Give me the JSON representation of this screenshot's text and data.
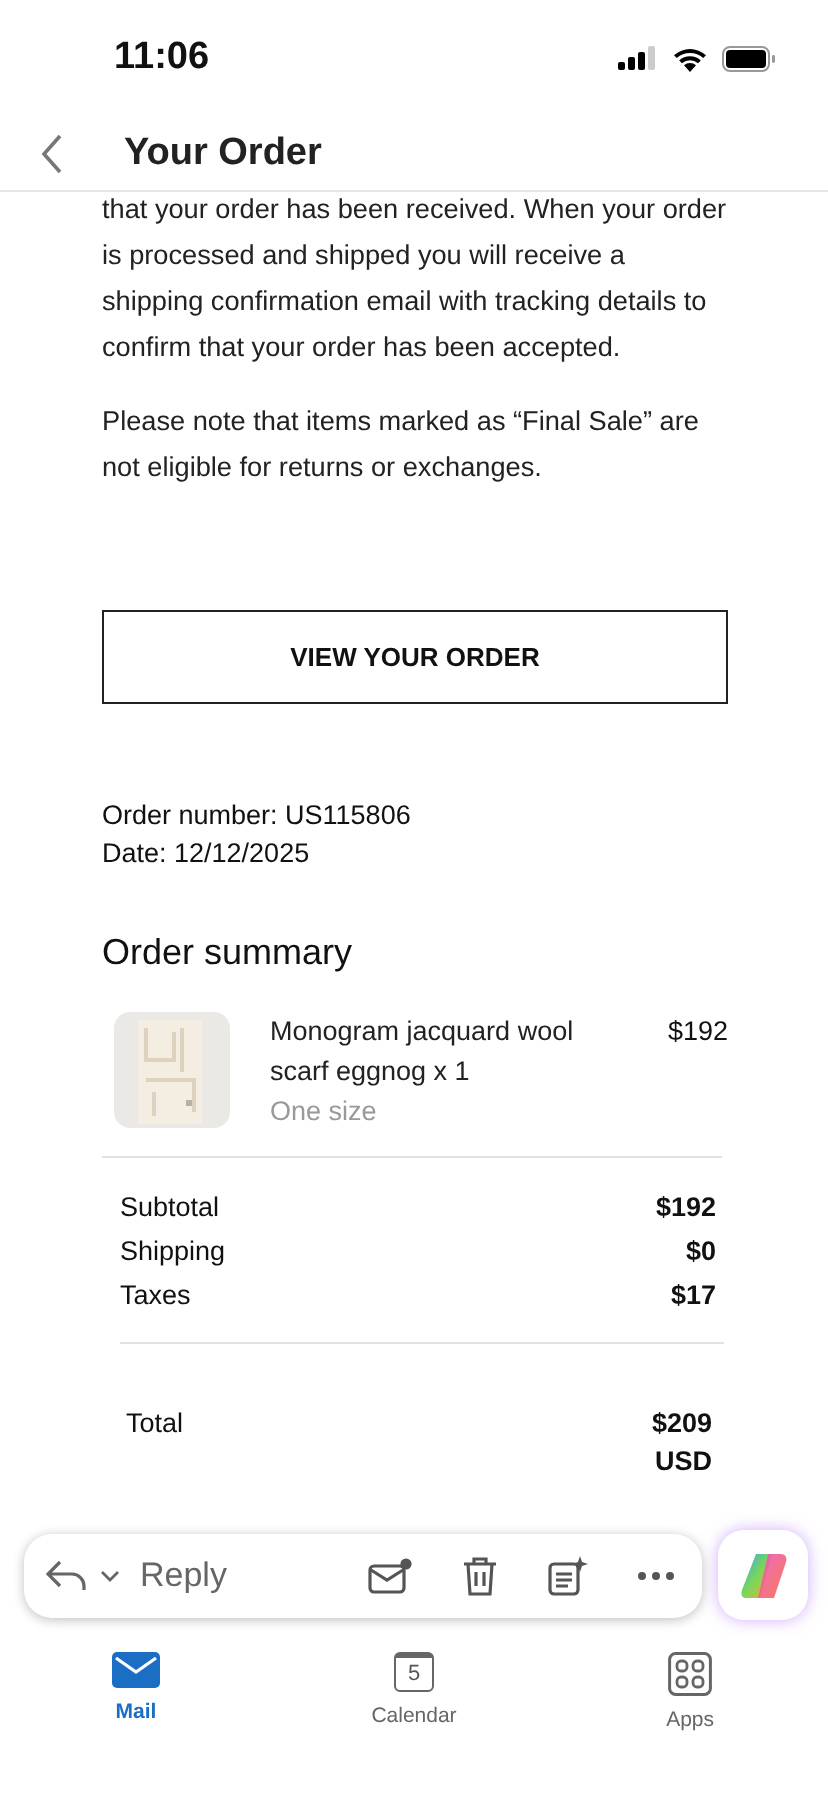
{
  "status_bar": {
    "time": "11:06"
  },
  "header": {
    "title": "Your Order"
  },
  "body": {
    "paragraphs": [
      "that your order has been received. When your order is processed and shipped you will receive a shipping confirmation email with tracking details to confirm that your order has been accepted.",
      "Please note that items marked as “Final Sale” are not eligible for returns or exchanges."
    ],
    "button": "VIEW YOUR ORDER",
    "order_number": "Order number: US115806",
    "date": "Date: 12/12/2025",
    "summary_title": "Order summary",
    "items": [
      {
        "name": "Monogram jacquard wool scarf eggnog x 1",
        "variant": "One size",
        "price": "$192",
        "kind": "picture"
      }
    ],
    "totals": [
      {
        "label": "Subtotal",
        "value": "$192"
      },
      {
        "label": "Shipping",
        "value": "$0"
      },
      {
        "label": "Taxes",
        "value": "$17"
      }
    ],
    "total": {
      "label": "Total",
      "value": "$209",
      "currency": "USD"
    }
  },
  "toolbar": {
    "reply": "Reply"
  },
  "tabs": [
    {
      "label": "Mail",
      "kind": "mail",
      "selected": true
    },
    {
      "label": "Calendar",
      "kind": "calendar",
      "selected": false,
      "day": "5"
    },
    {
      "label": "Apps",
      "kind": "apps",
      "selected": false
    }
  ]
}
